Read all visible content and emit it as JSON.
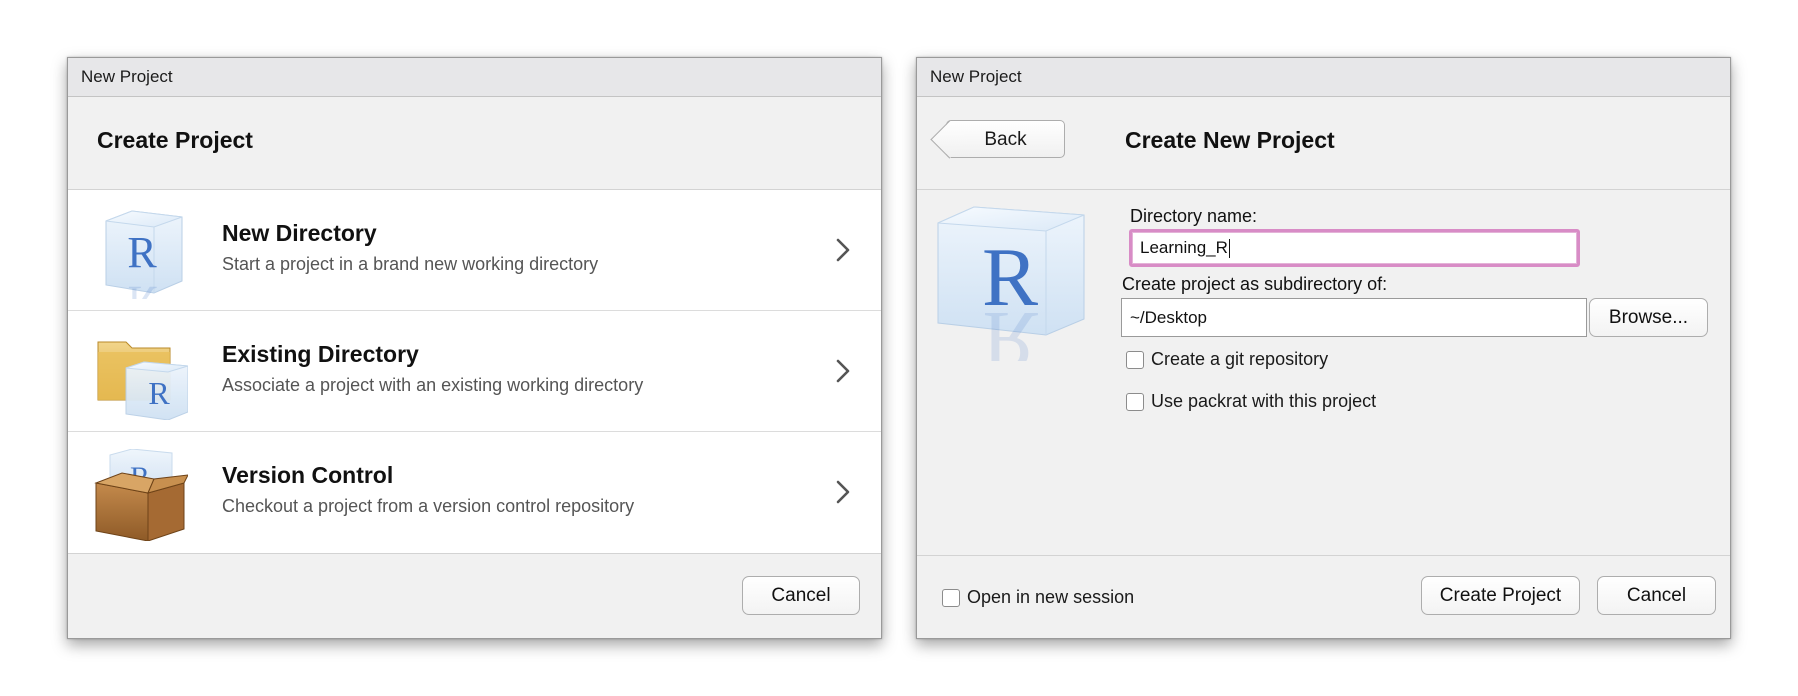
{
  "left_dialog": {
    "window_title": "New Project",
    "header_title": "Create Project",
    "options": [
      {
        "title": "New Directory",
        "description": "Start a project in a brand new working directory",
        "icon": "r-cube-icon"
      },
      {
        "title": "Existing Directory",
        "description": "Associate a project with an existing working directory",
        "icon": "folder-r-icon"
      },
      {
        "title": "Version Control",
        "description": "Checkout a project from a version control repository",
        "icon": "box-r-icon"
      }
    ],
    "cancel_label": "Cancel"
  },
  "right_dialog": {
    "window_title": "New Project",
    "back_label": "Back",
    "header_title": "Create New Project",
    "directory_name_label": "Directory name:",
    "directory_name_value": "Learning_R",
    "subdirectory_label": "Create project as subdirectory of:",
    "subdirectory_value": "~/Desktop",
    "browse_label": "Browse...",
    "git_label": "Create a git repository",
    "git_checked": false,
    "packrat_label": "Use packrat with this project",
    "packrat_checked": false,
    "new_session_label": "Open in new session",
    "new_session_checked": false,
    "create_label": "Create Project",
    "cancel_label": "Cancel",
    "icon": "r-cube-icon"
  },
  "colors": {
    "focus_ring": "#d88cc6",
    "r_blue": "#3f72c4",
    "dialog_bg": "#f1f1f1"
  }
}
